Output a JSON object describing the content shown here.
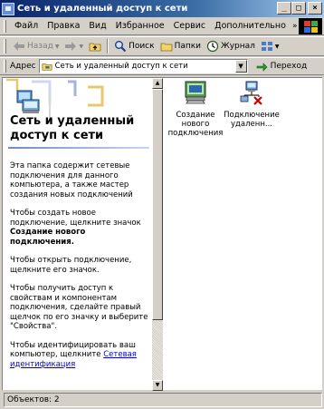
{
  "window": {
    "title": "Сеть и удаленный доступ к сети",
    "controls": {
      "minimize": "_",
      "maximize": "□",
      "close": "×"
    }
  },
  "menubar": {
    "items": [
      {
        "label": "Файл"
      },
      {
        "label": "Правка"
      },
      {
        "label": "Вид"
      },
      {
        "label": "Избранное"
      },
      {
        "label": "Сервис"
      },
      {
        "label": "Дополнительно"
      }
    ],
    "more": "»"
  },
  "toolbar": {
    "back": "Назад",
    "search": "Поиск",
    "folders": "Папки",
    "history": "Журнал"
  },
  "address": {
    "label": "Адрес",
    "value": "Сеть и удаленный доступ к сети",
    "go": "Переход"
  },
  "leftpane": {
    "title": "Сеть и удаленный доступ к сети",
    "para1": "Эта папка содержит сетевые подключения для данного компьютера, а также мастер создания новых подключений",
    "para2_pre": "Чтобы создать новое подключение, щелкните значок",
    "para2_bold": "Создание нового подключения.",
    "para3": "Чтобы открыть подключение, щелкните его значок.",
    "para4": "Чтобы получить доступ к свойствам и компонентам подключения, сделайте правый щелчок по его значку и выберите \"Свойства\".",
    "para5_pre": "Чтобы идентифицировать ваш компьютер, щелкните",
    "para5_link": "Сетевая идентификация"
  },
  "items": [
    {
      "label": "Создание нового подключения",
      "icon": "new-connection-wizard-icon"
    },
    {
      "label": "Подключение удаленн...",
      "icon": "disconnected-network-icon"
    }
  ],
  "status": {
    "text": "Объектов: 2"
  },
  "colors": {
    "title_start": "#0a246a",
    "title_end": "#a6caf0",
    "link": "#0000ee",
    "error_x": "#cc0000"
  }
}
